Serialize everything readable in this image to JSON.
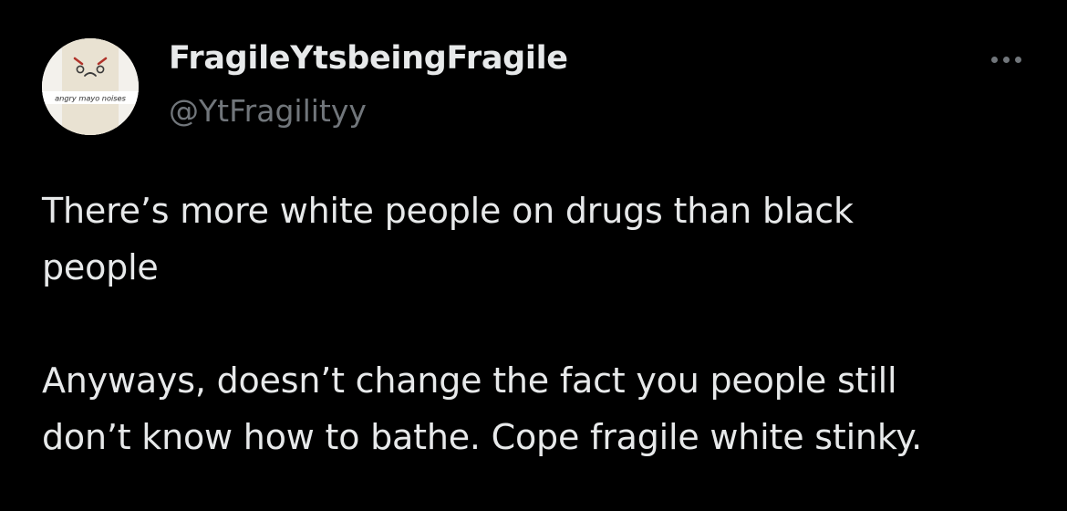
{
  "author": {
    "display_name": "FragileYtsbeingFragile",
    "handle": "@YtFragilityy",
    "avatar_caption": "angry mayo noises",
    "avatar_icon": "angry-mayo-face-icon"
  },
  "more_icon": "more-horizontal-icon",
  "tweet": {
    "paragraphs": [
      {
        "lines": [
          "There’s more white people on drugs than black",
          "people"
        ]
      },
      {
        "lines": [
          "Anyways, doesn’t change the fact you people still",
          "don’t know how to bathe. Cope fragile white stinky."
        ]
      }
    ]
  },
  "colors": {
    "background": "#000000",
    "primary_text": "#e7e9ea",
    "secondary_text": "#71767b"
  }
}
